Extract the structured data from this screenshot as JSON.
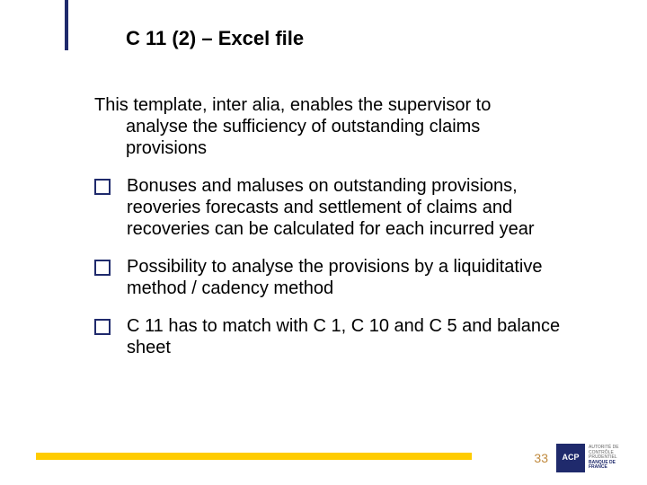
{
  "title": "C 11 (2) – Excel file",
  "intro_first": "This template, inter alia, enables the supervisor to",
  "intro_rest": "analyse the sufficiency of outstanding claims provisions",
  "bullets": [
    "Bonuses and maluses on outstanding provisions, reoveries forecasts and settlement of claims and recoveries can be calculated for each incurred year",
    "Possibility to analyse the provisions by a liquiditative method / cadency method",
    "C 11 has to match with C 1, C 10 and C 5 and balance sheet"
  ],
  "page_number": "33",
  "logo_abbr": "ACP",
  "logo_line1": "AUTORITÉ DE CONTRÔLE PRUDENTIEL",
  "logo_line2": "BANQUE DE FRANCE"
}
